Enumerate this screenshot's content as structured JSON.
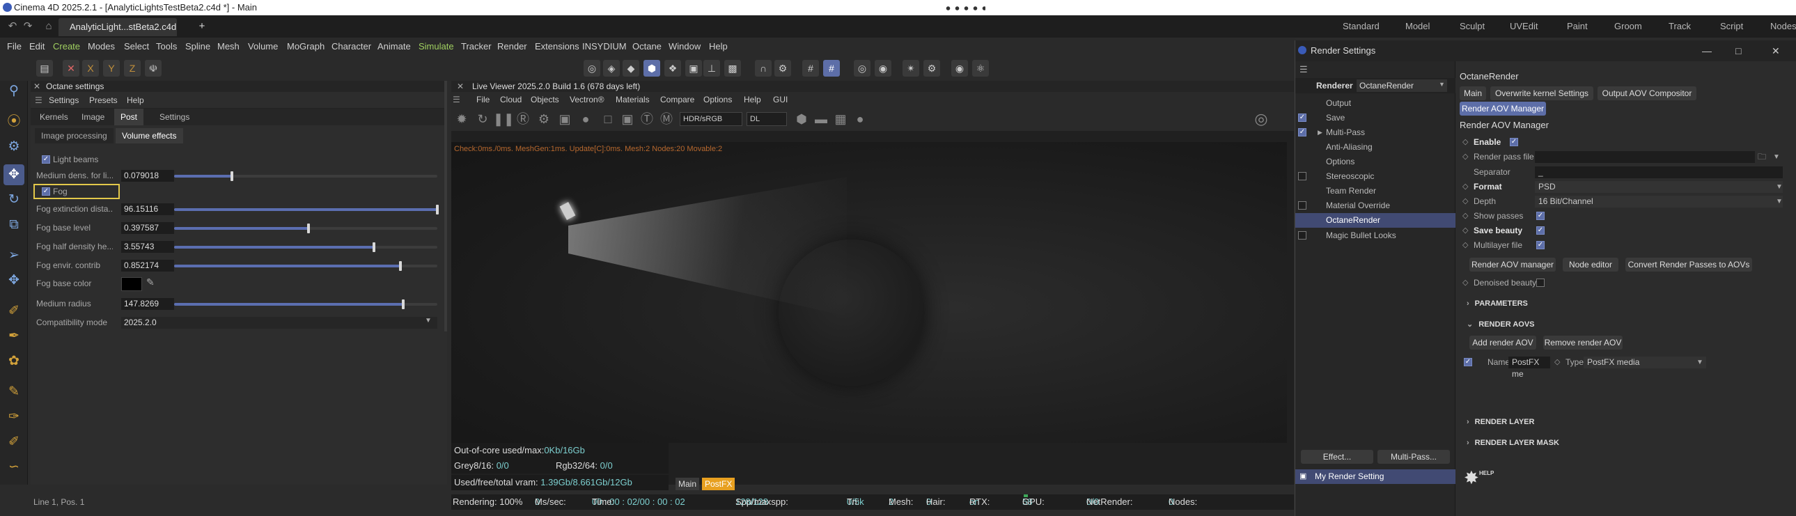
{
  "titlebar": {
    "title": "Cinema 4D 2025.2.1 - [AnalyticLightsTestBeta2.c4d *] - Main"
  },
  "tabs": {
    "doc_tab": "AnalyticLight...stBeta2.c4d *",
    "add": "+"
  },
  "layouts": [
    "Standard",
    "Model",
    "Sculpt",
    "UVEdit",
    "Paint",
    "Groom",
    "Track",
    "Script",
    "Nodes"
  ],
  "menu": [
    "File",
    "Edit",
    "Create",
    "Modes",
    "Select",
    "Tools",
    "Spline",
    "Mesh",
    "Volume",
    "MoGraph",
    "Character",
    "Animate",
    "Simulate",
    "Tracker",
    "Render",
    "Extensions",
    "INSYDIUM",
    "Octane",
    "Window",
    "Help"
  ],
  "coords": {
    "x": "X",
    "y": "Y",
    "z": "Z"
  },
  "octane_panel": {
    "title": "Octane settings",
    "menu": [
      "Settings",
      "Presets",
      "Help"
    ],
    "tabs": [
      "Kernels",
      "Image",
      "Post",
      "Settings"
    ],
    "subtabs": [
      "Image processing",
      "Volume effects"
    ],
    "light_beams": "Light beams",
    "fog": "Fog",
    "params": [
      {
        "label": "Medium dens. for li...",
        "value": "0.079018",
        "fill": 0.22
      },
      {
        "label": "Fog extinction dista...",
        "value": "96.15116",
        "fill": 1.0
      },
      {
        "label": "Fog base level",
        "value": "0.397587",
        "fill": 0.51
      },
      {
        "label": "Fog half density he...",
        "value": "3.55743",
        "fill": 0.76
      },
      {
        "label": "Fog envir. contrib",
        "value": "0.852174",
        "fill": 0.86
      }
    ],
    "fog_base_color": "Fog base color",
    "medium_radius": {
      "label": "Medium radius",
      "value": "147.8269",
      "fill": 0.87
    },
    "compat": {
      "label": "Compatibility mode",
      "value": "2025.2.0"
    }
  },
  "statusline": "Line 1, Pos. 1",
  "viewer": {
    "title": "Live Viewer 2025.2.0 Build 1.6 (678 days left)",
    "menu": [
      "File",
      "Cloud",
      "Objects",
      "Vectron®",
      "Materials",
      "Compare",
      "Options",
      "Help",
      "GUI"
    ],
    "colorspace": "HDR/sRGB",
    "kernel": "DL",
    "check_line": "Check:0ms./0ms. MeshGen:1ms. Update[C]:0ms. Mesh:2 Nodes:20 Movable:2",
    "ooc_label": "Out-of-core used/max:",
    "ooc_val": "0Kb/16Gb",
    "grey_label": "Grey8/16: ",
    "grey_val": "0/0",
    "rgb_label": "Rgb32/64: ",
    "rgb_val": "0/0",
    "vram_label": "Used/free/total vram: ",
    "vram_val": "1.39Gb/8.661Gb/12Gb",
    "main_tab": "Main",
    "postfx_tab": "PostFX",
    "render": {
      "rendering": "Rendering: 100%",
      "mssec_label": "Ms/sec: ",
      "mssec_val": "0",
      "time_label": "Time: ",
      "time_val": "00 : 00 : 02/00 : 00 : 02",
      "spp_label": "Spp/maxspp: ",
      "spp_val": "128/128",
      "tri_label": "Tri: ",
      "tri_val": "0/5k",
      "mesh_label": "Mesh: ",
      "mesh_val": "2",
      "hair_label": "Hair: ",
      "hair_val": "0",
      "rtx_label": "RTX:",
      "rtx_val": "on",
      "gpu_label": "GPU: ",
      "gpu_val": "58",
      "net_label": "NetRender: ",
      "net_val": "0/0",
      "nodes_label": "Nodes: ",
      "nodes_val": "0"
    }
  },
  "render_settings": {
    "title": "Render Settings",
    "renderer_label": "Renderer",
    "renderer": "OctaneRender",
    "list": [
      {
        "label": "Output",
        "cb": null
      },
      {
        "label": "Save",
        "cb": true
      },
      {
        "label": "Multi-Pass",
        "cb": true
      },
      {
        "label": "Anti-Aliasing",
        "cb": null
      },
      {
        "label": "Options",
        "cb": null
      },
      {
        "label": "Stereoscopic",
        "cb": false
      },
      {
        "label": "Team Render",
        "cb": null
      },
      {
        "label": "Material Override",
        "cb": false
      },
      {
        "label": "OctaneRender",
        "cb": null
      },
      {
        "label": "Magic Bullet Looks",
        "cb": false
      }
    ],
    "effect_btn": "Effect...",
    "multipass_btn": "Multi-Pass...",
    "setting_name": "My Render Setting",
    "right": {
      "heading": "OctaneRender",
      "tabs": [
        "Main",
        "Overwrite kernel Settings",
        "Output AOV Compositor",
        "Render AOV Manager"
      ],
      "section_title": "Render AOV Manager",
      "enable": "Enable",
      "render_pass_file": "Render pass file",
      "separator": "Separator",
      "separator_val": "_",
      "format": "Format",
      "format_val": "PSD",
      "depth": "Depth",
      "depth_val": "16 Bit/Channel",
      "show_passes": "Show passes",
      "save_beauty": "Save beauty",
      "multilayer": "Multilayer file",
      "buttons": [
        "Render AOV manager",
        "Node editor",
        "Convert Render Passes to AOVs"
      ],
      "denoised": "Denoised beauty",
      "parameters": "PARAMETERS",
      "render_aovs": "RENDER AOVS",
      "add_aov": "Add render AOV",
      "remove_aov": "Remove render AOV",
      "name_label": "Name",
      "name_val": "PostFX me",
      "type_label": "Type",
      "type_val": "PostFX media",
      "render_layer": "RENDER LAYER",
      "render_layer_mask": "RENDER LAYER MASK",
      "help": "HELP"
    }
  }
}
